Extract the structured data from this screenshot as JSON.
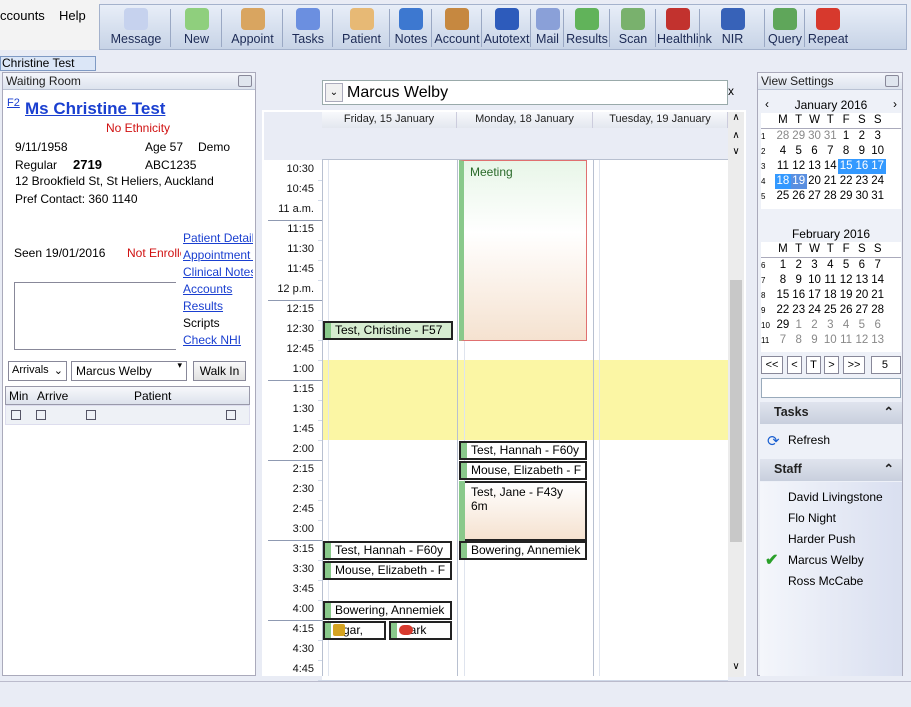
{
  "menu": {
    "accounts": "ccounts",
    "help": "Help"
  },
  "toolbar": [
    {
      "label": "Message",
      "icon": "speech-bubble-icon"
    },
    {
      "label": "New",
      "icon": "person-add-icon"
    },
    {
      "label": "Appoint",
      "icon": "calendar-12-icon"
    },
    {
      "label": "Tasks",
      "icon": "checklist-icon"
    },
    {
      "label": "Patient",
      "icon": "patient-icon"
    },
    {
      "label": "Notes",
      "icon": "notebook-icon"
    },
    {
      "label": "Account",
      "icon": "ledger-icon"
    },
    {
      "label": "Autotext",
      "icon": "autotext-a-icon"
    },
    {
      "label": "Mail",
      "icon": "mail-icon"
    },
    {
      "label": "Results",
      "icon": "flask-icon"
    },
    {
      "label": "Scan",
      "icon": "scan-doc-icon"
    },
    {
      "label": "Healthlink",
      "icon": "healthlink-icon"
    },
    {
      "label": "NIR",
      "icon": "globe-icon"
    },
    {
      "label": "Query",
      "icon": "chart-icon"
    },
    {
      "label": "Repeat",
      "icon": "pill-icon"
    }
  ],
  "patient_tab": "Christine Test",
  "waiting_room": {
    "title": "Waiting Room",
    "f2": "F2",
    "name": "Ms  Christine Test",
    "ethnicity": "No Ethnicity",
    "dob": "9/11/1958",
    "age": "Age 57",
    "demo": "Demo",
    "status": "Regular",
    "number": "2719",
    "nhi": "ABC1235",
    "address": "12 Brookfield St, St Heliers, Auckland",
    "pref_contact": "Pref Contact: 360 1140",
    "seen": "Seen 19/01/2016",
    "not_enrolled": "Not Enrolle",
    "links": [
      "Patient Details",
      "Appointment H",
      "Clinical Notes",
      "Accounts",
      "Results",
      "Scripts",
      "Check NHI"
    ],
    "arrivals": "Arrivals",
    "doctor": "Marcus Welby",
    "walk_in": "Walk In",
    "cols": [
      "Min",
      "Arrive",
      "Patient"
    ]
  },
  "diary": {
    "doctor": "Marcus Welby",
    "close": "x",
    "days": [
      "Friday, 15 January",
      "Monday, 18 January",
      "Tuesday, 19 January"
    ],
    "times": [
      "10:30",
      "10:45",
      "11 a.m.",
      "11:15",
      "11:30",
      "11:45",
      "12 p.m.",
      "12:15",
      "12:30",
      "12:45",
      "1:00",
      "1:15",
      "1:30",
      "1:45",
      "2:00",
      "2:15",
      "2:30",
      "2:45",
      "3:00",
      "3:15",
      "3:30",
      "3:45",
      "4:00",
      "4:15",
      "4:30",
      "4:45"
    ],
    "meeting": "Meeting",
    "appts": {
      "fri_1230": "Test, Christine - F57",
      "fri_315": "Test, Hannah - F60y",
      "fri_330": "Mouse, Elizabeth - F",
      "fri_400": "Bowering, Annemiek",
      "fri_415a": "Agar,",
      "fri_415b": "Hark",
      "mon_200": "Test, Hannah - F60y",
      "mon_215": "Mouse, Elizabeth - F",
      "mon_230a": "Test, Jane - F43y",
      "mon_230b": "6m",
      "mon_315": "Bowering, Annemiek"
    }
  },
  "right": {
    "view_settings": "View Settings",
    "jan_title": "January 2016",
    "feb_title": "February 2016",
    "dow": [
      "M",
      "T",
      "W",
      "T",
      "F",
      "S",
      "S"
    ],
    "jan": [
      [
        "1",
        "28",
        "29",
        "30",
        "31",
        "1",
        "2",
        "3"
      ],
      [
        "2",
        "4",
        "5",
        "6",
        "7",
        "8",
        "9",
        "10"
      ],
      [
        "3",
        "11",
        "12",
        "13",
        "14",
        "15",
        "16",
        "17"
      ],
      [
        "4",
        "18",
        "19",
        "20",
        "21",
        "22",
        "23",
        "24"
      ],
      [
        "5",
        "25",
        "26",
        "27",
        "28",
        "29",
        "30",
        "31"
      ]
    ],
    "feb": [
      [
        "6",
        "1",
        "2",
        "3",
        "4",
        "5",
        "6",
        "7"
      ],
      [
        "7",
        "8",
        "9",
        "10",
        "11",
        "12",
        "13",
        "14"
      ],
      [
        "8",
        "15",
        "16",
        "17",
        "18",
        "19",
        "20",
        "21"
      ],
      [
        "9",
        "22",
        "23",
        "24",
        "25",
        "26",
        "27",
        "28"
      ],
      [
        "10",
        "29",
        "1",
        "2",
        "3",
        "4",
        "5",
        "6"
      ],
      [
        "11",
        "7",
        "8",
        "9",
        "10",
        "11",
        "12",
        "13"
      ]
    ],
    "nav": [
      "<<",
      "<",
      "T",
      ">",
      ">>"
    ],
    "spin": "5",
    "tasks": "Tasks",
    "refresh": "Refresh",
    "staff_title": "Staff",
    "staff": [
      "David Livingstone",
      "Flo Night",
      "Harder Push",
      "Marcus Welby",
      "Ross McCabe"
    ]
  }
}
